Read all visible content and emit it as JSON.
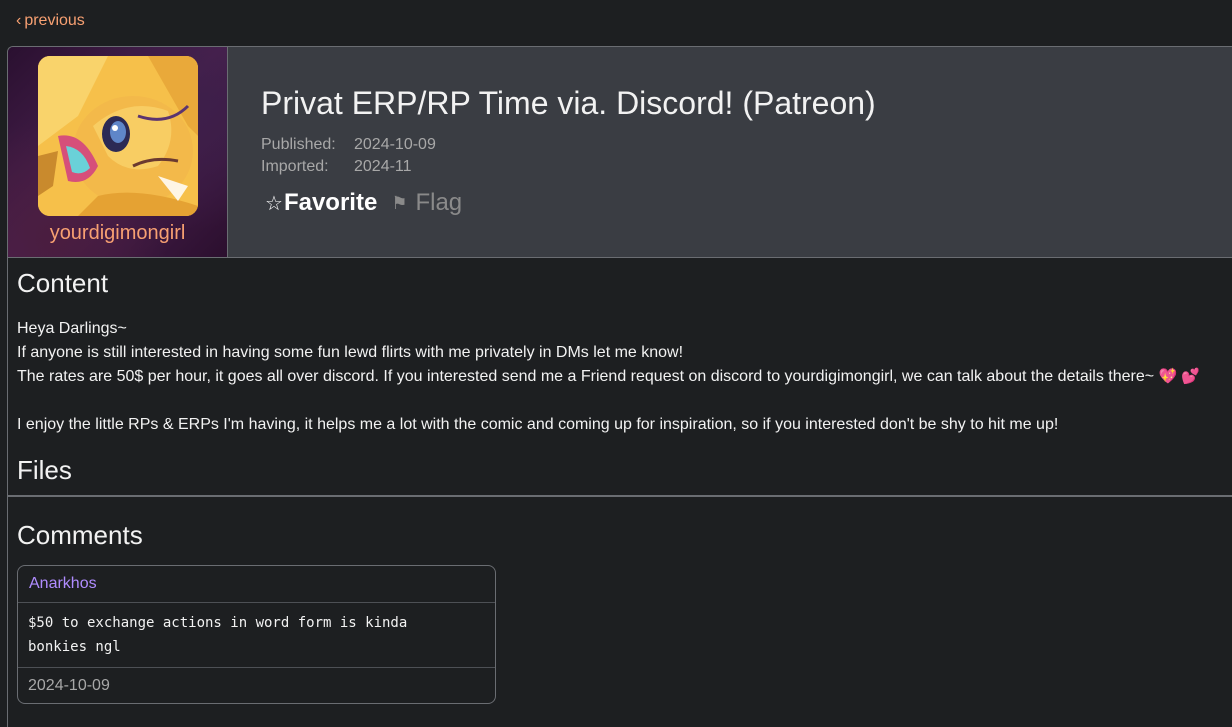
{
  "nav": {
    "previous_chevron": "‹",
    "previous_label": "previous"
  },
  "user": {
    "name": "yourdigimongirl"
  },
  "post": {
    "title": "Privat ERP/RP Time via. Discord! (Patreon)",
    "published_label": "Published:",
    "published_value": "2024-10-09",
    "imported_label": "Imported:",
    "imported_value": "2024-11"
  },
  "actions": {
    "favorite_star": "☆",
    "favorite_label": "Favorite",
    "flag_icon": "⚑",
    "flag_label": "Flag"
  },
  "sections": {
    "content_heading": "Content",
    "files_heading": "Files",
    "comments_heading": "Comments"
  },
  "content": {
    "line1": "Heya Darlings~",
    "line2": "If anyone is still interested in having some fun lewd flirts with me privately in DMs let me know!",
    "line3": "The rates are 50$ per hour, it goes all over discord. If you interested send me a Friend request on discord to yourdigimongirl, we can talk about the details there~",
    "line3_emoji": "💖 💕",
    "line4": "I enjoy the little RPs & ERPs I'm having, it helps me a lot with the comic and coming up for inspiration, so if you interested don't be shy to hit me up!"
  },
  "comments": [
    {
      "author": "Anarkhos",
      "text_line1": "$50 to exchange actions in word form is kinda",
      "text_line2": "bonkies ngl",
      "date": "2024-10-09"
    }
  ],
  "colors": {
    "background": "#1d1f21",
    "header": "#3a3d43",
    "link": "#f7a072",
    "comment_author": "#b08cff",
    "muted": "#a8a8a8"
  },
  "icons": [
    "chevron-left-icon",
    "star-outline-icon",
    "flag-icon"
  ]
}
